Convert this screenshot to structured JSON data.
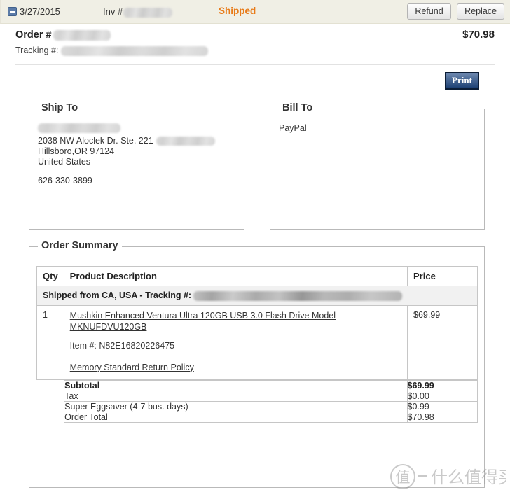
{
  "order_bar": {
    "collapse_icon": "minus-box-icon",
    "date": "3/27/2015",
    "invoice_label": "Inv #",
    "invoice_number_redacted": true,
    "status": "Shipped",
    "status_color": "#e87b19",
    "refund_label": "Refund",
    "replace_label": "Replace"
  },
  "order_header": {
    "order_label": "Order #",
    "order_number_redacted": true,
    "tracking_label": "Tracking #:",
    "tracking_number_redacted": true,
    "order_amount": "$70.98"
  },
  "actions": {
    "print_label": "Print"
  },
  "ship_to": {
    "legend": "Ship To",
    "recipient_redacted": true,
    "address_line1": "2038 NW Aloclek Dr. Ste. 221",
    "address_line2": "Hillsboro,OR 97124",
    "country": "United States",
    "phone": "626-330-3899"
  },
  "bill_to": {
    "legend": "Bill To",
    "payment_method": "PayPal"
  },
  "order_summary": {
    "legend": "Order Summary",
    "columns": [
      "Qty",
      "Product Description",
      "Price"
    ],
    "shipment_note": "Shipped from CA, USA - Tracking #:",
    "shipment_tracking_redacted": true,
    "items": [
      {
        "qty": "1",
        "title": "Mushkin Enhanced Ventura Ultra 120GB USB 3.0 Flash Drive Model MKNUFDVU120GB",
        "item_number": "Item #: N82E16820226475",
        "return_policy": "Memory Standard Return Policy",
        "price": "$69.99"
      }
    ],
    "totals": [
      {
        "label": "Subtotal",
        "value": "$69.99",
        "bold": true
      },
      {
        "label": "Tax",
        "value": "$0.00",
        "bold": false
      },
      {
        "label": "Super Eggsaver (4-7 bus. days)",
        "value": "$0.99",
        "bold": false
      },
      {
        "label": "Order Total",
        "value": "$70.98",
        "bold": false
      }
    ]
  },
  "watermark": {
    "text": "值—什么值得买"
  }
}
